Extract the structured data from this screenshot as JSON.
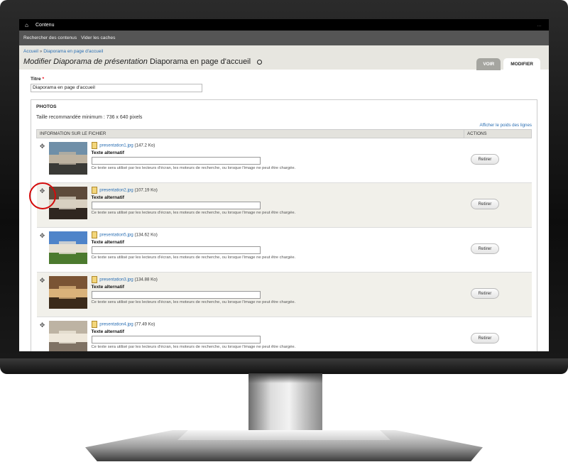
{
  "toolbar": {
    "home_icon": "home-icon",
    "contenu": "Contenu"
  },
  "shortcuts": {
    "items": [
      "Rechercher des contenus",
      "Vider les caches"
    ]
  },
  "breadcrumb": {
    "home": "Accueil",
    "separator": "»",
    "current": "Diaporama en page d'accueil"
  },
  "page": {
    "title_prefix": "Modifier Diaporama de présentation",
    "title_main": "Diaporama en page d'accueil"
  },
  "tabs": {
    "voir": "VOIR",
    "modifier": "MODIFIER"
  },
  "form": {
    "titre_label": "Titre",
    "required_mark": "*",
    "titre_value": "Diaporama en page d'accueil",
    "photos_legend": "PHOTOS",
    "taille": "Taille recommandée minimum : 736 x 640 pixels",
    "weights_link": "Afficher le poids des lignes",
    "col_info": "INFORMATION SUR LE FICHIER",
    "col_actions": "ACTIONS",
    "alt_label": "Texte alternatif",
    "help_text": "Ce texte sera utilisé par les lecteurs d'écran, les moteurs de recherche, ou lorsque l'image ne peut être chargée.",
    "remove_label": "Retirer",
    "files": [
      {
        "name": "presentation1.jpg",
        "size": "(147.2 Ko)",
        "thumb_colors": [
          "#6f8fa8",
          "#bdb2a0",
          "#3a3a36"
        ]
      },
      {
        "name": "presentation2.jpg",
        "size": "(107.19 Ko)",
        "thumb_colors": [
          "#5d4a3a",
          "#d8cfc0",
          "#2f2620"
        ]
      },
      {
        "name": "presentation5.jpg",
        "size": "(134.62 Ko)",
        "thumb_colors": [
          "#4f84c9",
          "#e6e0d3",
          "#4c7a2e"
        ]
      },
      {
        "name": "presentation3.jpg",
        "size": "(134.88 Ko)",
        "thumb_colors": [
          "#7a5434",
          "#d9b27a",
          "#3b2a1a"
        ]
      },
      {
        "name": "presentation4.jpg",
        "size": "(77.49 Ko)",
        "thumb_colors": [
          "#bdb3a3",
          "#eee7da",
          "#7f7264"
        ]
      }
    ]
  }
}
